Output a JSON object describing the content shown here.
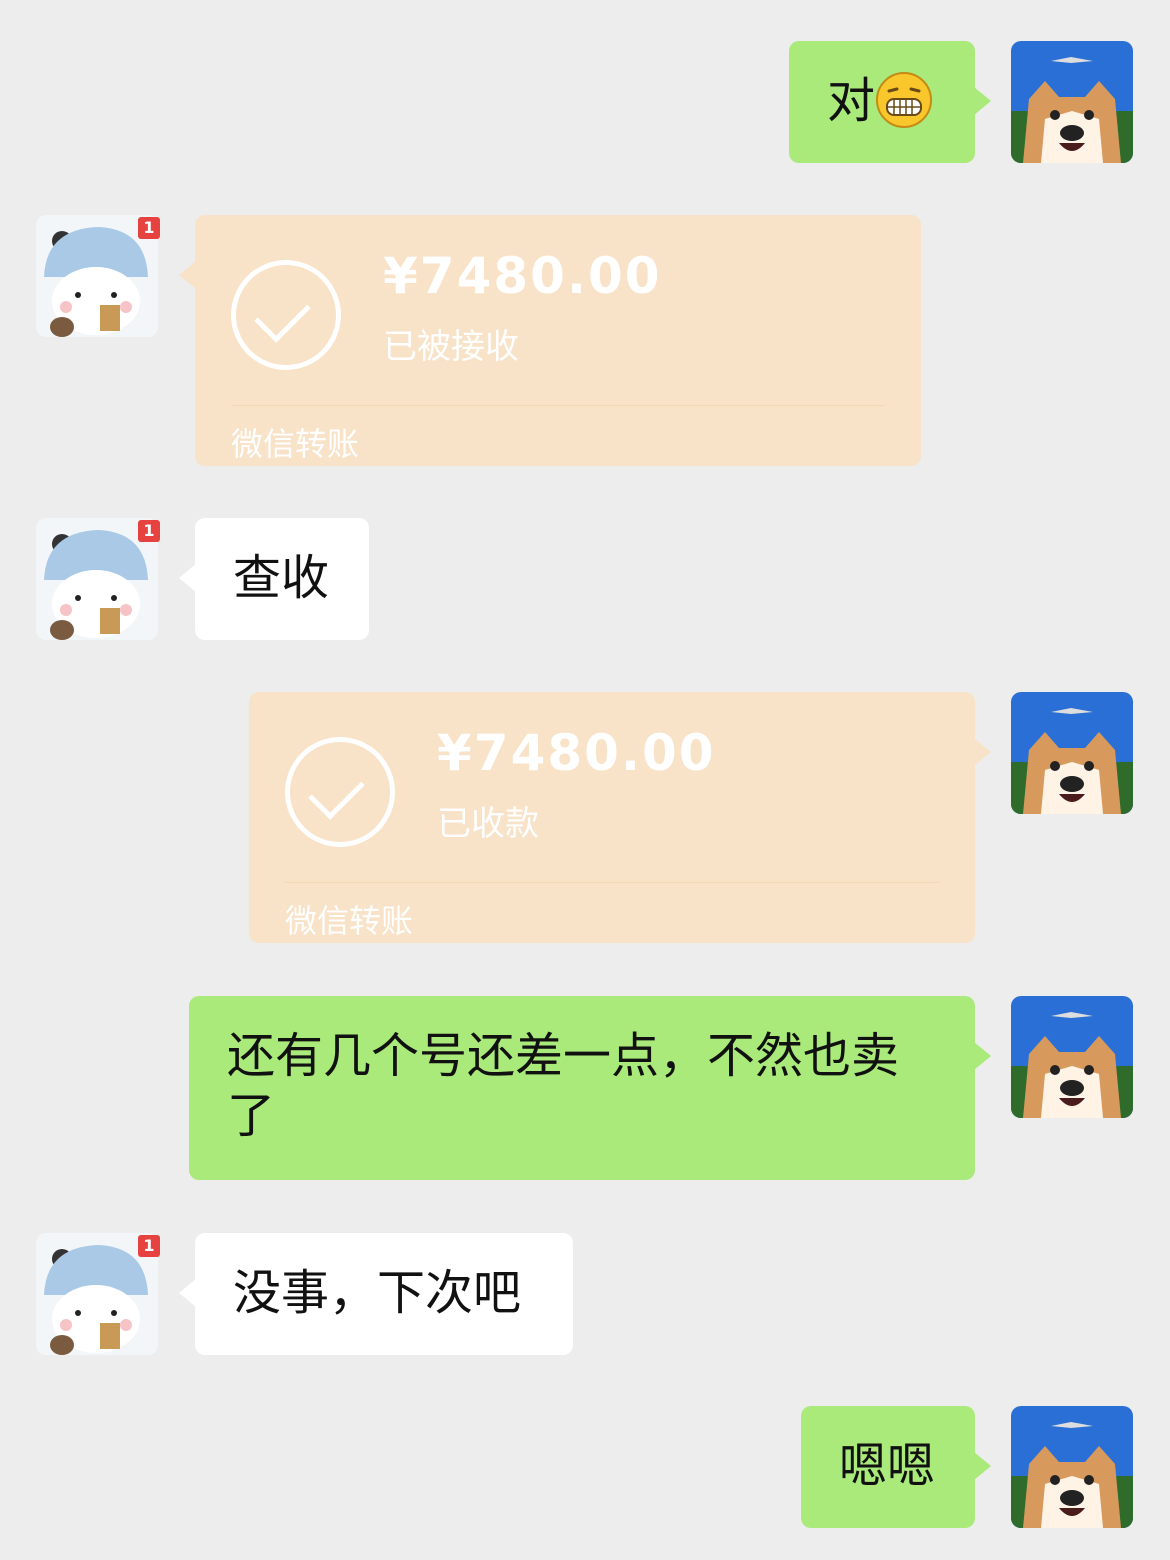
{
  "messages": [
    {
      "id": "m1",
      "side": "right",
      "text": "对"
    },
    {
      "id": "m2",
      "side": "left",
      "type": "transfer",
      "amount": "¥7480.00",
      "status": "已被接收",
      "brand": "微信转账"
    },
    {
      "id": "m3",
      "side": "left",
      "text": "查收"
    },
    {
      "id": "m4",
      "side": "right",
      "type": "transfer",
      "amount": "¥7480.00",
      "status": "已收款",
      "brand": "微信转账"
    },
    {
      "id": "m5",
      "side": "right",
      "text": "还有几个号还差一点，不然也卖了"
    },
    {
      "id": "m6",
      "side": "left",
      "text": "没事，下次吧"
    },
    {
      "id": "m7",
      "side": "right",
      "text": "嗯嗯"
    }
  ],
  "contact": {
    "badge": "1"
  },
  "icons": {
    "self_avatar": "shiba-dog-avatar",
    "contact_avatar": "cartoon-bear-avatar",
    "emoji": "grin-emoji"
  },
  "colors": {
    "background": "#ededed",
    "self_bubble": "#a9ea7a",
    "other_bubble": "#ffffff",
    "transfer_bubble": "#f8e2c8"
  }
}
